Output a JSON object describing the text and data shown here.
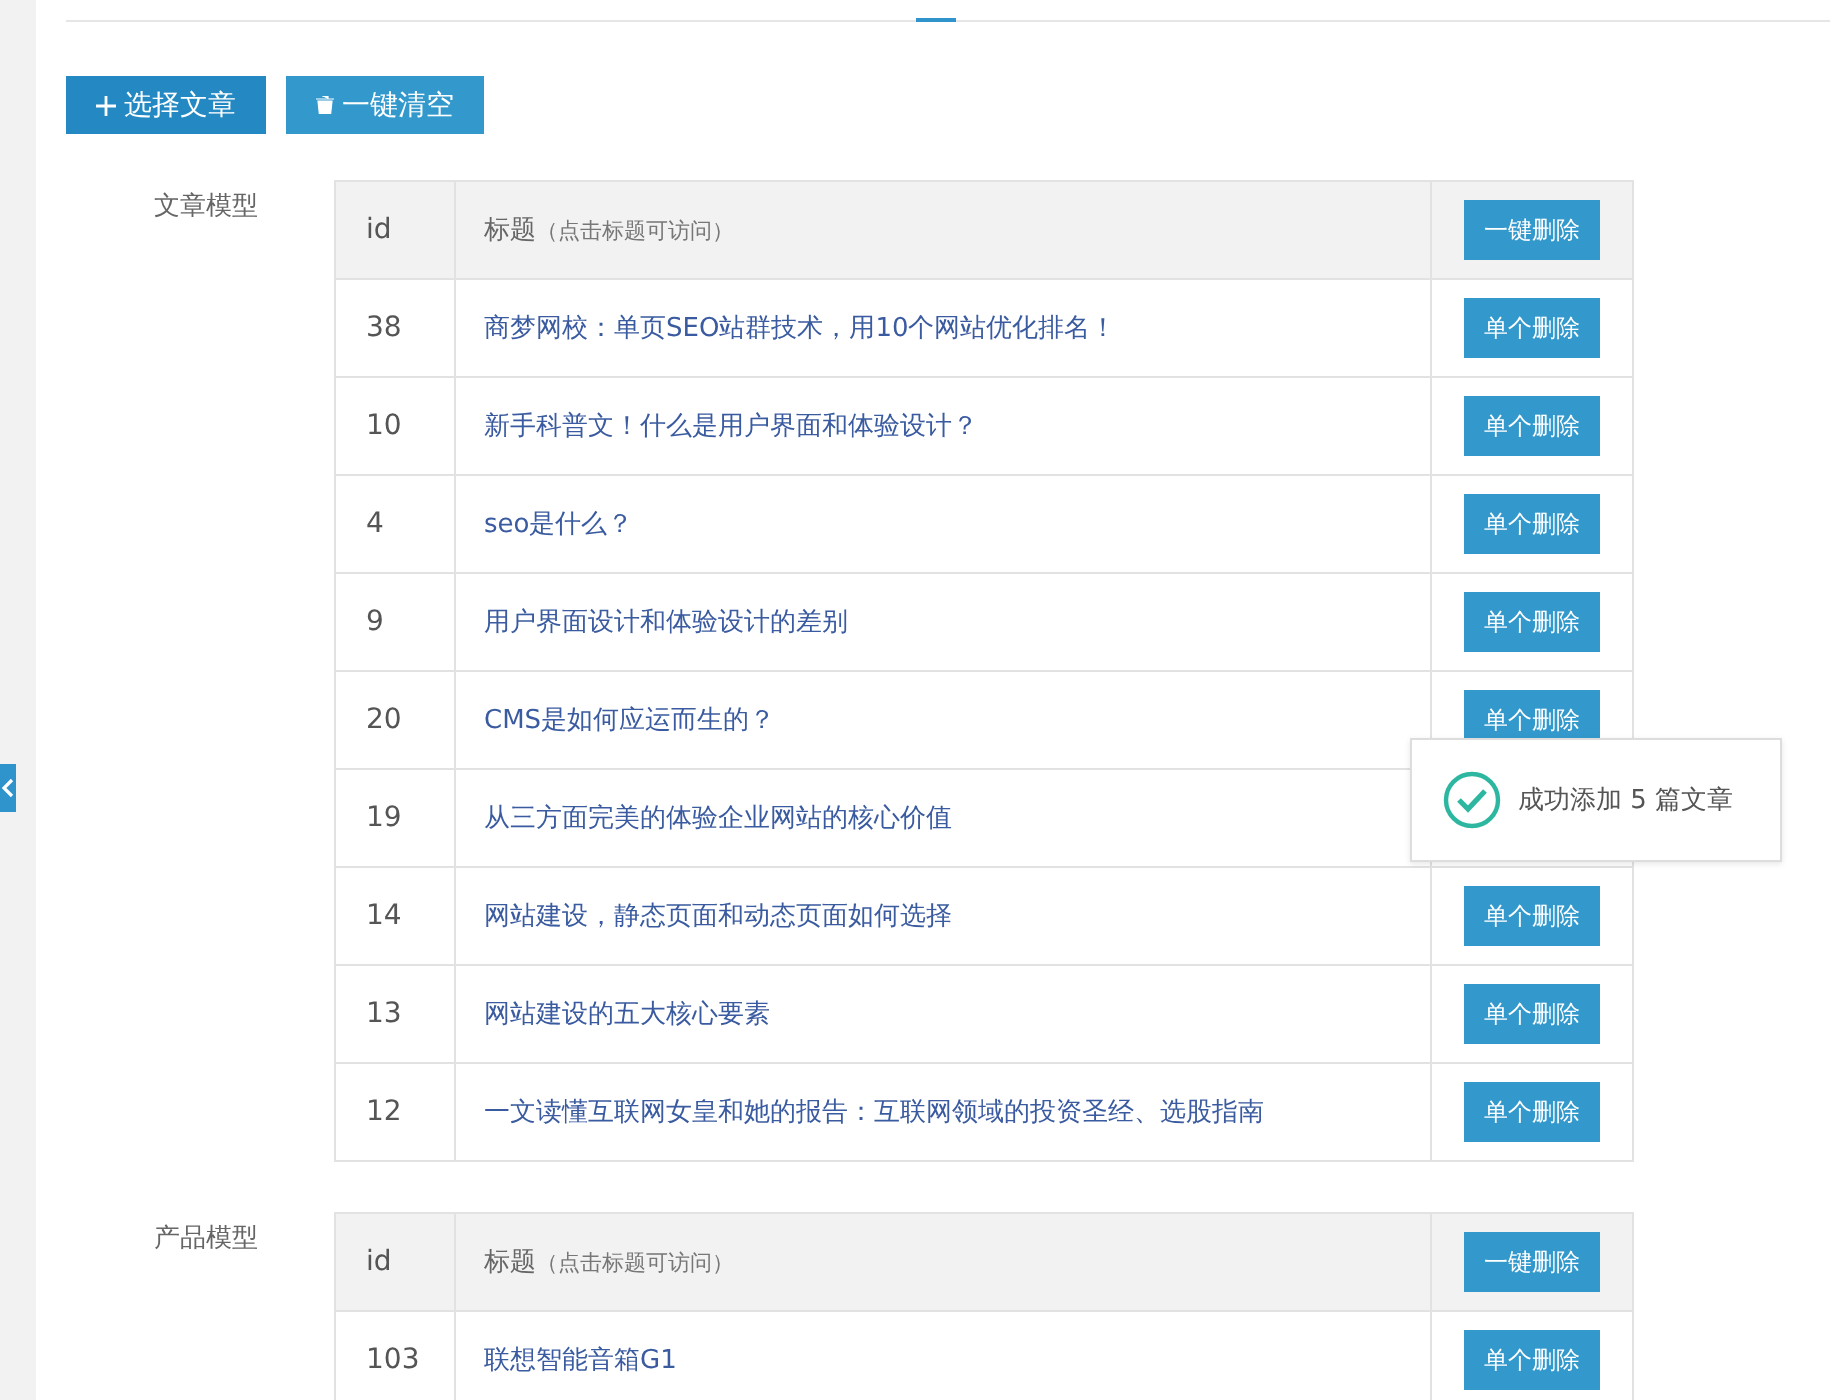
{
  "toolbar": {
    "buttons": [
      {
        "kind": "add",
        "label": "选择文章"
      },
      {
        "kind": "clear",
        "label": "一键清空"
      }
    ]
  },
  "sections": [
    {
      "label": "文章模型",
      "columns": {
        "id": "id",
        "title": "标题",
        "hint": "（点击标题可访问）",
        "action": "一键删除"
      },
      "rows": [
        {
          "id": "38",
          "title": "商梦网校：单页SEO站群技术，用10个网站优化排名！",
          "action": "单个删除"
        },
        {
          "id": "10",
          "title": "新手科普文！什么是用户界面和体验设计？",
          "action": "单个删除"
        },
        {
          "id": "4",
          "title": "seo是什么？",
          "action": "单个删除"
        },
        {
          "id": "9",
          "title": "用户界面设计和体验设计的差别",
          "action": "单个删除"
        },
        {
          "id": "20",
          "title": "CMS是如何应运而生的？",
          "action": "单个删除"
        },
        {
          "id": "19",
          "title": "从三方面完美的体验企业网站的核心价值"
        },
        {
          "id": "14",
          "title": "网站建设，静态页面和动态页面如何选择",
          "action": "单个删除"
        },
        {
          "id": "13",
          "title": "网站建设的五大核心要素",
          "action": "单个删除"
        },
        {
          "id": "12",
          "title": "一文读懂互联网女皇和她的报告：互联网领域的投资圣经、选股指南",
          "action": "单个删除"
        }
      ]
    },
    {
      "label": "产品模型",
      "columns": {
        "id": "id",
        "title": "标题",
        "hint": "（点击标题可访问）",
        "action": "一键删除"
      },
      "rows": [
        {
          "id": "103",
          "title": "联想智能音箱G1",
          "action": "单个删除"
        }
      ]
    }
  ],
  "toast": {
    "message": "成功添加 5 篇文章"
  }
}
